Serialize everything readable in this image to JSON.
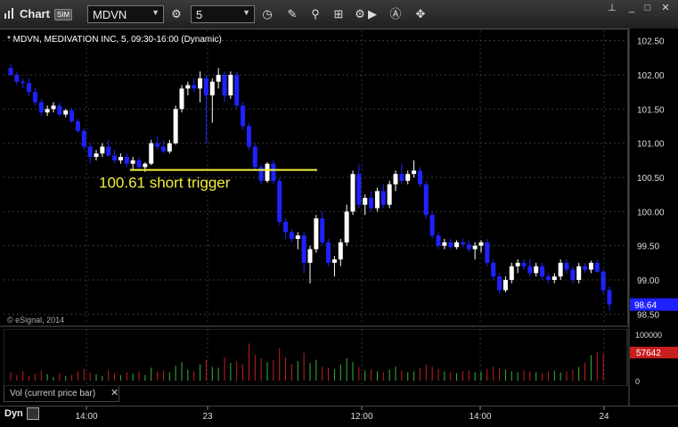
{
  "toolbar": {
    "app_title": "Chart",
    "sim_badge": "SIM",
    "symbol": "MDVN",
    "interval": "5"
  },
  "chart_header": "* MDVN, MEDIVATION INC, 5, 09:30-16:00 (Dynamic)",
  "copyright": "© eSignal, 2014",
  "annotation": "100.61 short trigger",
  "annotation_color": "#f2ef3a",
  "up_color": "#ffffff",
  "down_color": "#1f22ff",
  "vol_up_color": "#37b437",
  "vol_down_color": "#c81e1e",
  "vol_legend": "Vol (current price bar)",
  "bottom": {
    "mode": "Dyn"
  },
  "chart_data": {
    "type": "candlestick",
    "price_ticks": [
      "102.50",
      "102.00",
      "101.50",
      "101.00",
      "100.50",
      "100.00",
      "99.50",
      "99.00",
      "98.50"
    ],
    "price_ylim": [
      98.4,
      102.6
    ],
    "last_price": "98.64",
    "trigger_level": 100.61,
    "volume_ticks": [
      "100000",
      "0"
    ],
    "last_volume": "57642",
    "x_tick_labels": [
      "14:00",
      "23",
      "12:00",
      "14:00",
      "24"
    ],
    "candles": [
      [
        102.1,
        102.15,
        101.98,
        102.0
      ],
      [
        102.0,
        102.05,
        101.85,
        101.9
      ],
      [
        101.9,
        101.95,
        101.8,
        101.88
      ],
      [
        101.88,
        101.95,
        101.7,
        101.75
      ],
      [
        101.75,
        101.8,
        101.55,
        101.6
      ],
      [
        101.6,
        101.65,
        101.4,
        101.45
      ],
      [
        101.45,
        101.55,
        101.4,
        101.5
      ],
      [
        101.5,
        101.6,
        101.45,
        101.55
      ],
      [
        101.55,
        101.6,
        101.4,
        101.42
      ],
      [
        101.42,
        101.5,
        101.38,
        101.48
      ],
      [
        101.48,
        101.52,
        101.3,
        101.32
      ],
      [
        101.32,
        101.36,
        101.15,
        101.18
      ],
      [
        101.18,
        101.22,
        100.9,
        100.95
      ],
      [
        100.95,
        101.0,
        100.7,
        100.8
      ],
      [
        100.8,
        100.9,
        100.75,
        100.85
      ],
      [
        100.85,
        101.0,
        100.8,
        100.95
      ],
      [
        100.95,
        101.05,
        100.8,
        100.82
      ],
      [
        100.82,
        100.9,
        100.7,
        100.75
      ],
      [
        100.75,
        100.85,
        100.7,
        100.8
      ],
      [
        100.8,
        100.85,
        100.65,
        100.7
      ],
      [
        100.7,
        100.8,
        100.6,
        100.75
      ],
      [
        100.75,
        100.8,
        100.62,
        100.65
      ],
      [
        100.65,
        100.72,
        100.58,
        100.7
      ],
      [
        100.7,
        101.05,
        100.68,
        101.0
      ],
      [
        101.0,
        101.1,
        100.9,
        100.95
      ],
      [
        100.95,
        101.05,
        100.85,
        100.88
      ],
      [
        100.88,
        101.05,
        100.85,
        101.0
      ],
      [
        101.0,
        101.55,
        100.98,
        101.5
      ],
      [
        101.5,
        101.85,
        101.45,
        101.8
      ],
      [
        101.8,
        101.9,
        101.7,
        101.85
      ],
      [
        101.85,
        101.95,
        101.75,
        101.8
      ],
      [
        101.8,
        102.05,
        101.6,
        101.95
      ],
      [
        101.95,
        102.0,
        101.0,
        101.7
      ],
      [
        101.7,
        101.95,
        101.3,
        101.9
      ],
      [
        101.9,
        102.1,
        101.8,
        102.0
      ],
      [
        102.0,
        102.05,
        101.6,
        101.7
      ],
      [
        101.7,
        102.05,
        101.65,
        102.0
      ],
      [
        102.0,
        102.05,
        101.5,
        101.55
      ],
      [
        101.55,
        101.6,
        101.2,
        101.25
      ],
      [
        101.25,
        101.3,
        100.9,
        100.95
      ],
      [
        100.95,
        101.0,
        100.6,
        100.65
      ],
      [
        100.65,
        100.7,
        100.4,
        100.45
      ],
      [
        100.45,
        100.72,
        100.42,
        100.7
      ],
      [
        100.7,
        100.75,
        100.4,
        100.45
      ],
      [
        100.45,
        100.5,
        99.8,
        99.85
      ],
      [
        99.85,
        99.9,
        99.6,
        99.7
      ],
      [
        99.7,
        99.75,
        99.55,
        99.6
      ],
      [
        99.6,
        99.7,
        99.45,
        99.65
      ],
      [
        99.65,
        99.7,
        99.1,
        99.25
      ],
      [
        99.25,
        99.5,
        98.95,
        99.45
      ],
      [
        99.45,
        99.95,
        99.4,
        99.9
      ],
      [
        99.9,
        100.0,
        99.5,
        99.55
      ],
      [
        99.55,
        99.6,
        99.2,
        99.25
      ],
      [
        99.25,
        99.35,
        99.05,
        99.3
      ],
      [
        99.3,
        99.6,
        99.2,
        99.55
      ],
      [
        99.55,
        100.1,
        99.5,
        100.0
      ],
      [
        100.0,
        100.6,
        99.95,
        100.55
      ],
      [
        100.55,
        100.7,
        100.05,
        100.1
      ],
      [
        100.1,
        100.25,
        99.95,
        100.2
      ],
      [
        100.2,
        100.3,
        100.0,
        100.05
      ],
      [
        100.05,
        100.35,
        100.0,
        100.3
      ],
      [
        100.3,
        100.4,
        100.05,
        100.1
      ],
      [
        100.1,
        100.45,
        100.05,
        100.4
      ],
      [
        100.4,
        100.6,
        100.3,
        100.55
      ],
      [
        100.55,
        100.7,
        100.4,
        100.45
      ],
      [
        100.45,
        100.6,
        100.4,
        100.55
      ],
      [
        100.55,
        100.75,
        100.5,
        100.6
      ],
      [
        100.6,
        100.65,
        100.35,
        100.4
      ],
      [
        100.4,
        100.45,
        99.9,
        99.95
      ],
      [
        99.95,
        100.0,
        99.6,
        99.65
      ],
      [
        99.65,
        99.7,
        99.45,
        99.5
      ],
      [
        99.5,
        99.6,
        99.45,
        99.55
      ],
      [
        99.55,
        99.6,
        99.45,
        99.48
      ],
      [
        99.48,
        99.58,
        99.45,
        99.55
      ],
      [
        99.55,
        99.6,
        99.48,
        99.52
      ],
      [
        99.52,
        99.58,
        99.4,
        99.45
      ],
      [
        99.45,
        99.55,
        99.3,
        99.5
      ],
      [
        99.5,
        99.58,
        99.4,
        99.55
      ],
      [
        99.55,
        99.6,
        99.2,
        99.25
      ],
      [
        99.25,
        99.3,
        99.0,
        99.05
      ],
      [
        99.05,
        99.1,
        98.8,
        98.85
      ],
      [
        98.85,
        99.05,
        98.82,
        99.0
      ],
      [
        99.0,
        99.25,
        98.95,
        99.2
      ],
      [
        99.2,
        99.3,
        99.1,
        99.25
      ],
      [
        99.25,
        99.3,
        99.15,
        99.2
      ],
      [
        99.2,
        99.3,
        99.05,
        99.1
      ],
      [
        99.1,
        99.25,
        99.05,
        99.2
      ],
      [
        99.2,
        99.25,
        99.0,
        99.05
      ],
      [
        99.05,
        99.1,
        98.95,
        99.0
      ],
      [
        99.0,
        99.1,
        98.95,
        99.05
      ],
      [
        99.05,
        99.3,
        99.0,
        99.25
      ],
      [
        99.25,
        99.3,
        99.1,
        99.15
      ],
      [
        99.15,
        99.2,
        98.95,
        99.0
      ],
      [
        99.0,
        99.25,
        98.95,
        99.2
      ],
      [
        99.2,
        99.25,
        99.1,
        99.15
      ],
      [
        99.15,
        99.28,
        99.1,
        99.25
      ],
      [
        99.25,
        99.3,
        99.1,
        99.12
      ],
      [
        99.12,
        99.15,
        98.8,
        98.85
      ],
      [
        98.85,
        98.9,
        98.55,
        98.64
      ]
    ],
    "volumes": [
      18,
      12,
      20,
      10,
      15,
      22,
      14,
      8,
      16,
      10,
      12,
      20,
      25,
      18,
      14,
      10,
      22,
      16,
      12,
      18,
      15,
      20,
      12,
      28,
      20,
      22,
      18,
      32,
      40,
      24,
      20,
      35,
      45,
      30,
      28,
      50,
      38,
      42,
      35,
      80,
      55,
      48,
      40,
      45,
      70,
      50,
      35,
      42,
      60,
      38,
      45,
      30,
      28,
      25,
      35,
      48,
      40,
      30,
      22,
      25,
      20,
      18,
      24,
      30,
      22,
      18,
      20,
      28,
      35,
      30,
      25,
      20,
      18,
      16,
      20,
      22,
      18,
      20,
      25,
      30,
      28,
      24,
      20,
      18,
      22,
      20,
      18,
      16,
      20,
      22,
      18,
      20,
      24,
      30,
      38,
      55,
      62,
      58
    ]
  }
}
